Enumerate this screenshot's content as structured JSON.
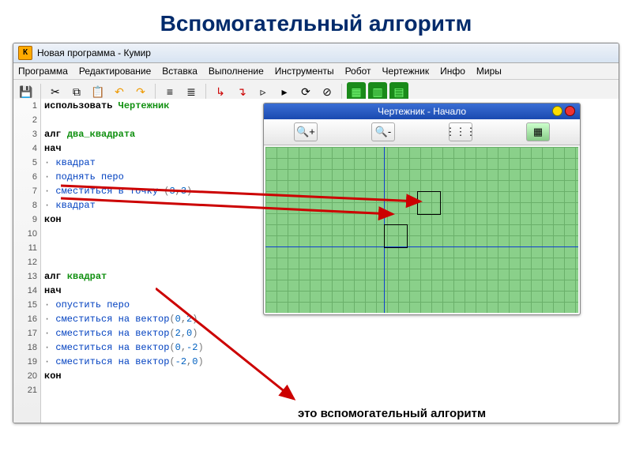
{
  "slide": {
    "title": "Вспомогательный алгоритм"
  },
  "window": {
    "title": "Новая программа - Кумир",
    "icon": "К"
  },
  "menu": [
    "Программа",
    "Редактирование",
    "Вставка",
    "Выполнение",
    "Инструменты",
    "Робот",
    "Чертежник",
    "Инфо",
    "Миры"
  ],
  "code": {
    "lines": [
      {
        "n": 1,
        "html": [
          [
            "kw",
            "использовать "
          ],
          [
            "name",
            "Чертежник"
          ]
        ]
      },
      {
        "n": 2,
        "html": []
      },
      {
        "n": 3,
        "html": [
          [
            "kw",
            "алг "
          ],
          [
            "name",
            "два_квадрата"
          ]
        ]
      },
      {
        "n": 4,
        "html": [
          [
            "kw",
            "нач"
          ]
        ]
      },
      {
        "n": 5,
        "html": [
          [
            "dot",
            "· "
          ],
          [
            "cmd",
            "квадрат"
          ]
        ]
      },
      {
        "n": 6,
        "html": [
          [
            "dot",
            "· "
          ],
          [
            "cmd",
            "поднять перо"
          ]
        ]
      },
      {
        "n": 7,
        "html": [
          [
            "dot",
            "· "
          ],
          [
            "cmd",
            "сместиться в точку "
          ],
          [
            "paren",
            "("
          ],
          [
            "num",
            "3"
          ],
          [
            "paren",
            ","
          ],
          [
            "num",
            "3"
          ],
          [
            "paren",
            ")"
          ]
        ]
      },
      {
        "n": 8,
        "html": [
          [
            "dot",
            "· "
          ],
          [
            "cmd",
            "квадрат"
          ]
        ]
      },
      {
        "n": 9,
        "html": [
          [
            "kw",
            "кон"
          ]
        ]
      },
      {
        "n": 10,
        "html": []
      },
      {
        "n": 11,
        "html": []
      },
      {
        "n": 12,
        "html": []
      },
      {
        "n": 13,
        "html": [
          [
            "kw",
            "алг "
          ],
          [
            "name",
            "квадрат"
          ]
        ]
      },
      {
        "n": 14,
        "html": [
          [
            "kw",
            "нач"
          ]
        ]
      },
      {
        "n": 15,
        "html": [
          [
            "dot",
            "· "
          ],
          [
            "cmd",
            "опустить перо"
          ]
        ]
      },
      {
        "n": 16,
        "html": [
          [
            "dot",
            "· "
          ],
          [
            "cmd",
            "сместиться на вектор"
          ],
          [
            "paren",
            "("
          ],
          [
            "num",
            "0"
          ],
          [
            "paren",
            ","
          ],
          [
            "num",
            "2"
          ],
          [
            "paren",
            ")"
          ]
        ]
      },
      {
        "n": 17,
        "html": [
          [
            "dot",
            "· "
          ],
          [
            "cmd",
            "сместиться на вектор"
          ],
          [
            "paren",
            "("
          ],
          [
            "num",
            "2"
          ],
          [
            "paren",
            ","
          ],
          [
            "num",
            "0"
          ],
          [
            "paren",
            ")"
          ]
        ]
      },
      {
        "n": 18,
        "html": [
          [
            "dot",
            "· "
          ],
          [
            "cmd",
            "сместиться на вектор"
          ],
          [
            "paren",
            "("
          ],
          [
            "num",
            "0"
          ],
          [
            "paren",
            ","
          ],
          [
            "num",
            "-2"
          ],
          [
            "paren",
            ")"
          ]
        ]
      },
      {
        "n": 19,
        "html": [
          [
            "dot",
            "· "
          ],
          [
            "cmd",
            "сместиться на вектор"
          ],
          [
            "paren",
            "("
          ],
          [
            "num",
            "-2"
          ],
          [
            "paren",
            ","
          ],
          [
            "num",
            "0"
          ],
          [
            "paren",
            ")"
          ]
        ]
      },
      {
        "n": 20,
        "html": [
          [
            "kw",
            "кон"
          ]
        ]
      },
      {
        "n": 21,
        "html": []
      }
    ]
  },
  "tool_window": {
    "title": "Чертежник - Начало"
  },
  "annotation": "это вспомогательный алгоритм",
  "icons": {
    "save": "💾",
    "cut": "✂",
    "copy": "⧉",
    "paste": "📋",
    "undo": "↶",
    "redo": "↷",
    "list1": "≡",
    "list2": "≣",
    "step1": "↳",
    "step2": "↴",
    "run1": "▹",
    "run2": "▸",
    "run3": "⟳",
    "stop": "⊘",
    "zoom_in": "🔍+",
    "zoom_out": "🔍-",
    "grid": "⋮⋮⋮",
    "layers": "▦"
  }
}
